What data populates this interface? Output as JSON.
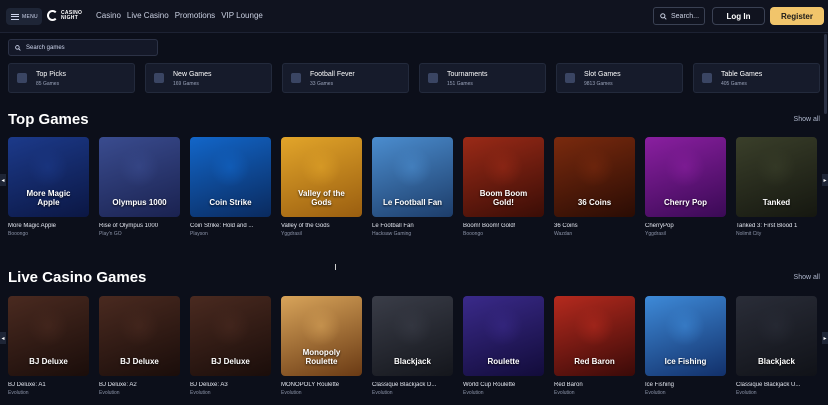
{
  "header": {
    "menu_label": "MENU",
    "logo_line1": "CASINO",
    "logo_line2": "NIGHT",
    "nav": [
      "Casino",
      "Live Casino",
      "Promotions",
      "VIP Lounge"
    ],
    "search_label": "Search...",
    "login_label": "Log In",
    "register_label": "Register"
  },
  "search_games": {
    "placeholder": "Search games"
  },
  "categories": [
    {
      "title": "Top Picks",
      "count": "85 Games"
    },
    {
      "title": "New Games",
      "count": "169 Games"
    },
    {
      "title": "Football Fever",
      "count": "33 Games"
    },
    {
      "title": "Tournaments",
      "count": "151 Games"
    },
    {
      "title": "Slot Games",
      "count": "9813 Games"
    },
    {
      "title": "Table Games",
      "count": "405 Games"
    }
  ],
  "top_games": {
    "title": "Top Games",
    "show_all": "Show all",
    "items": [
      {
        "name": "More Magic Apple",
        "provider": "Booongo",
        "art": "More Magic Apple",
        "c1": "#1c3a8a",
        "c2": "#0b1744"
      },
      {
        "name": "Rise of Olympus 1000",
        "provider": "Play'n GO",
        "art": "Olympus 1000",
        "c1": "#3a4c8f",
        "c2": "#1a2250"
      },
      {
        "name": "Coin Strike: Hold and ...",
        "provider": "Playson",
        "art": "Coin Strike",
        "c1": "#1266c9",
        "c2": "#0a2a5e"
      },
      {
        "name": "Valley of the Gods",
        "provider": "Yggdrasil",
        "art": "Valley of the Gods",
        "c1": "#e2a52a",
        "c2": "#9a5e10"
      },
      {
        "name": "Le Football Fan",
        "provider": "Hacksaw Gaming",
        "art": "Le Football Fan",
        "c1": "#4b8dcf",
        "c2": "#1d3d6a"
      },
      {
        "name": "Boom! Boom! Gold!",
        "provider": "Booongo",
        "art": "Boom Boom Gold!",
        "c1": "#9a2a17",
        "c2": "#3a0d06"
      },
      {
        "name": "36 Coins",
        "provider": "Wazdan",
        "art": "36 Coins",
        "c1": "#7a2a0e",
        "c2": "#2a0c04"
      },
      {
        "name": "CherryPop",
        "provider": "Yggdrasil",
        "art": "Cherry Pop",
        "c1": "#8a1fa0",
        "c2": "#3a0a55"
      },
      {
        "name": "Tanked 3: First Blood 1",
        "provider": "Nolimit City",
        "art": "Tanked",
        "c1": "#3a3f2a",
        "c2": "#151710"
      }
    ]
  },
  "live_games": {
    "title": "Live Casino Games",
    "show_all": "Show all",
    "items": [
      {
        "name": "BJ Deluxe: A1",
        "provider": "Evolution",
        "art": "BJ Deluxe",
        "c1": "#4a2a20",
        "c2": "#1a0d0a"
      },
      {
        "name": "BJ Deluxe: A2",
        "provider": "Evolution",
        "art": "BJ Deluxe",
        "c1": "#4a2a20",
        "c2": "#1a0d0a"
      },
      {
        "name": "BJ Deluxe: A3",
        "provider": "Evolution",
        "art": "BJ Deluxe",
        "c1": "#4a2a20",
        "c2": "#1a0d0a"
      },
      {
        "name": "MONOPOLY Roulette",
        "provider": "Evolution",
        "art": "Monopoly Roulette",
        "c1": "#d8a45a",
        "c2": "#6a3a14"
      },
      {
        "name": "Classique Blackjack D...",
        "provider": "Evolution",
        "art": "Blackjack",
        "c1": "#3a3d48",
        "c2": "#14161c"
      },
      {
        "name": "World Cup Roulette",
        "provider": "Evolution",
        "art": "Roulette",
        "c1": "#3a2a8a",
        "c2": "#120c3a"
      },
      {
        "name": "Red Baron",
        "provider": "Evolution",
        "art": "Red Baron",
        "c1": "#b52a1e",
        "c2": "#3a0a08"
      },
      {
        "name": "Ice Fishing",
        "provider": "Evolution",
        "art": "Ice Fishing",
        "c1": "#3e8ad8",
        "c2": "#12306a"
      },
      {
        "name": "Classique Blackjack U...",
        "provider": "Evolution",
        "art": "Blackjack",
        "c1": "#2a2d38",
        "c2": "#101218"
      }
    ]
  }
}
